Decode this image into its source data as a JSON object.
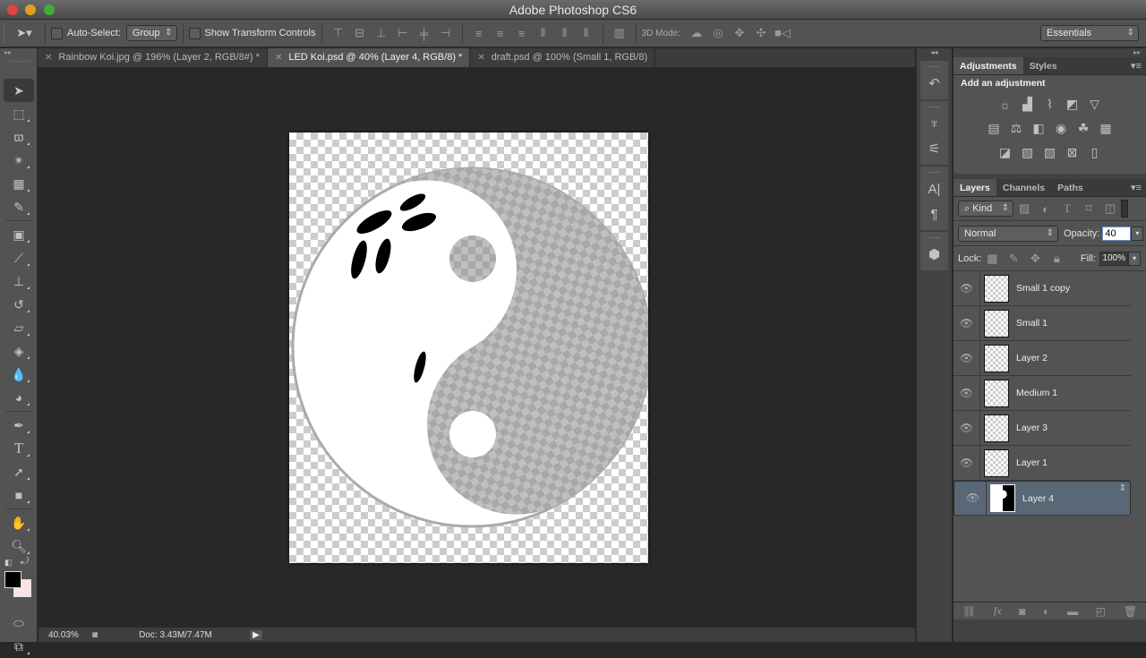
{
  "window": {
    "title": "Adobe Photoshop CS6"
  },
  "options_bar": {
    "auto_select_label": "Auto-Select:",
    "auto_select_value": "Group",
    "show_transform_label": "Show Transform Controls",
    "mode_3d_label": "3D Mode:",
    "workspace": "Essentials"
  },
  "tabs": [
    {
      "label": "Rainbow Koi.jpg @ 196% (Layer 2, RGB/8#) *",
      "active": false
    },
    {
      "label": "LED Koi.psd @ 40% (Layer 4, RGB/8) *",
      "active": true
    },
    {
      "label": "draft.psd @ 100% (Small 1, RGB/8)",
      "active": false
    }
  ],
  "tools": [
    "move-tool",
    "marquee-tool",
    "lasso-tool",
    "magic-wand-tool",
    "crop-tool",
    "eyedropper-tool",
    "healing-brush-tool",
    "brush-tool",
    "clone-stamp-tool",
    "history-brush-tool",
    "eraser-tool",
    "paint-bucket-tool",
    "blur-tool",
    "dodge-tool",
    "pen-tool",
    "type-tool",
    "path-selection-tool",
    "rectangle-tool",
    "hand-tool",
    "zoom-tool"
  ],
  "colors": {
    "foreground": "#000000",
    "background": "#fbe3e3",
    "selected_layer": "#596776"
  },
  "status": {
    "zoom": "40.03%",
    "doc": "Doc: 3.43M/7.47M"
  },
  "adjustments": {
    "tabs": [
      "Adjustments",
      "Styles"
    ],
    "heading": "Add an adjustment"
  },
  "layers_panel": {
    "tabs": [
      "Layers",
      "Channels",
      "Paths"
    ],
    "filter_kind": "Kind",
    "blend_mode": "Normal",
    "opacity_label": "Opacity:",
    "opacity_value": "40",
    "lock_label": "Lock:",
    "fill_label": "Fill:",
    "fill_value": "100%",
    "layers": [
      {
        "name": "Small 1 copy",
        "visible": true,
        "selected": false
      },
      {
        "name": "Small 1",
        "visible": true,
        "selected": false
      },
      {
        "name": "Layer 2",
        "visible": true,
        "selected": false
      },
      {
        "name": "Medium 1",
        "visible": true,
        "selected": false
      },
      {
        "name": "Layer 3",
        "visible": true,
        "selected": false
      },
      {
        "name": "Layer 1",
        "visible": true,
        "selected": false
      },
      {
        "name": "Layer 4",
        "visible": true,
        "selected": true
      }
    ]
  }
}
